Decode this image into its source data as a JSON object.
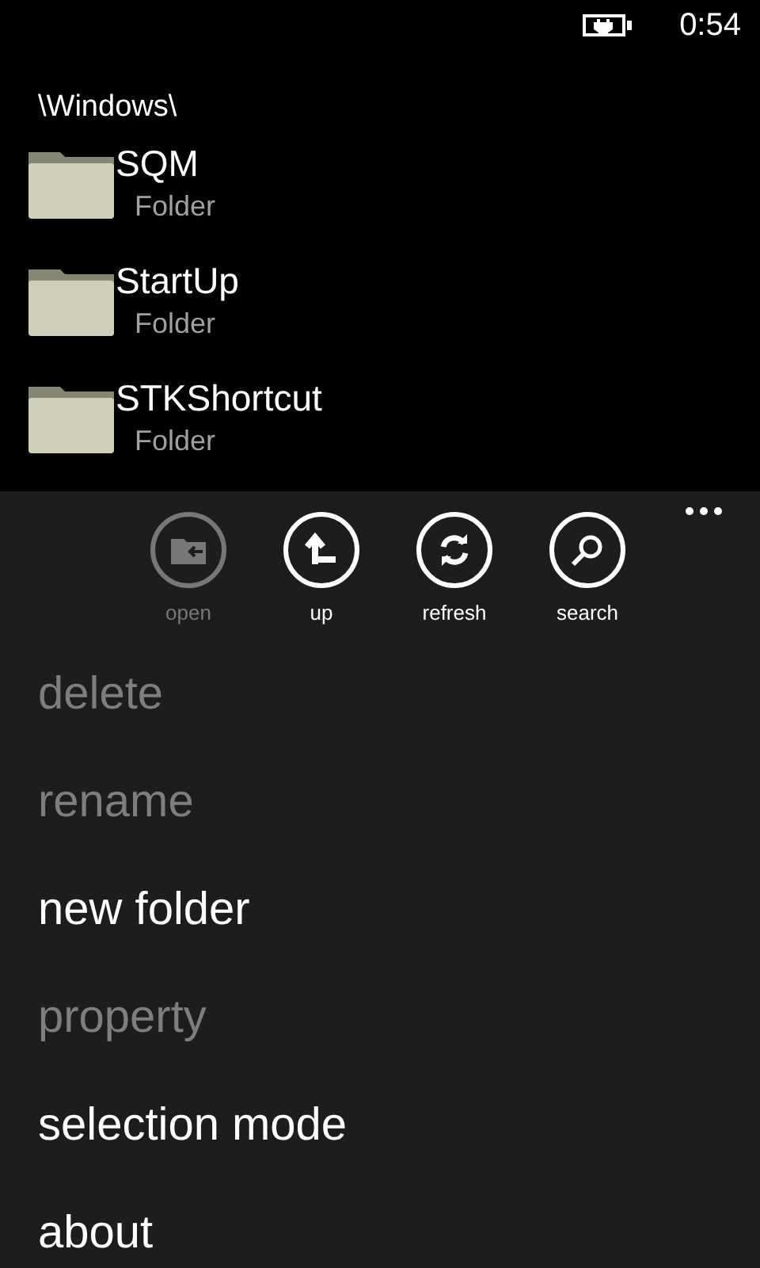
{
  "status_bar": {
    "time": "0:54"
  },
  "path": "\\Windows\\",
  "items": [
    {
      "name": "SQM",
      "type": "Folder"
    },
    {
      "name": "StartUp",
      "type": "Folder"
    },
    {
      "name": "STKShortcut",
      "type": "Folder"
    }
  ],
  "app_bar": {
    "buttons": [
      {
        "kind": "open",
        "label": "open",
        "disabled": true
      },
      {
        "kind": "up",
        "label": "up",
        "disabled": false
      },
      {
        "kind": "refresh",
        "label": "refresh",
        "disabled": false
      },
      {
        "kind": "search",
        "label": "search",
        "disabled": false
      }
    ],
    "menu": [
      {
        "label": "delete",
        "disabled": true
      },
      {
        "label": "rename",
        "disabled": true
      },
      {
        "label": "new folder",
        "disabled": false
      },
      {
        "label": "property",
        "disabled": true
      },
      {
        "label": "selection mode",
        "disabled": false
      },
      {
        "label": "about",
        "disabled": false
      }
    ]
  }
}
